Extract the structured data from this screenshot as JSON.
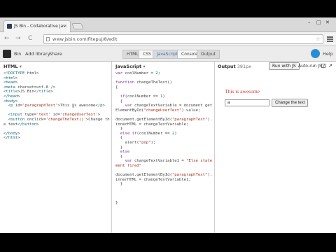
{
  "browser": {
    "tab_title": "JS Bin - Collaborative Jav",
    "url": "www.jsbin.com/fitepuj/8/edit",
    "back_glyph": "←",
    "forward_glyph": "→",
    "reload_glyph": "C",
    "win_min": "–",
    "win_max": "□",
    "win_close": "✕"
  },
  "toolbar": {
    "logo_glyph": "",
    "bin_label": "Bin",
    "add_library": "Add library",
    "share": "Share",
    "panels": [
      "HTML",
      "CSS",
      "JavaScript",
      "Console",
      "Output"
    ],
    "login_glyph": "",
    "help": "Help"
  },
  "html_panel": {
    "label": "HTML",
    "lines": [
      "<!DOCTYPE html>",
      "<html>",
      "<head>",
      "<meta charset=utf-8 />",
      "<title>JS Bin</title>",
      "</head>",
      "<body>",
      "  <p id='paragraphText'>This is awesome</p>",
      "",
      "  <input type='text' id='changeUserText'>",
      "  <button onclick='changeTheText()'>Change the text</button>",
      "",
      "</body>",
      "</html>"
    ]
  },
  "js_panel": {
    "label": "JavaScript",
    "lines": [
      "var coolNumber = 2;",
      "",
      "function changeTheText()",
      "{",
      "",
      "  if(coolNumber == 1)",
      "  {",
      "    var changeTextVariable = document.getElementById(\"changeUserText\").value;",
      "",
      "document.getElementById(\"paragraphText\").innerHTML = changeTextVariable;",
      "  }",
      "  else if(coolNumber == 2)",
      "  {",
      "    alert(\"pop\");",
      "  }",
      "  else",
      "  {",
      "    var changeTextVariable1 = \"Else statement fired\"",
      "",
      "document.getElementById(\"paragraphText\").innerHTML = changeTextVariable1;",
      "  }",
      "",
      "",
      "",
      "}"
    ]
  },
  "output_panel": {
    "label": "Output",
    "size": "381px",
    "run_button": "Run with JS",
    "auto_run": "Auto-run JS",
    "auto_run_checked": "✓",
    "popout_glyph": "↗",
    "paragraph": "This is awesome",
    "input_value": "a",
    "button_label": "Change the text"
  }
}
